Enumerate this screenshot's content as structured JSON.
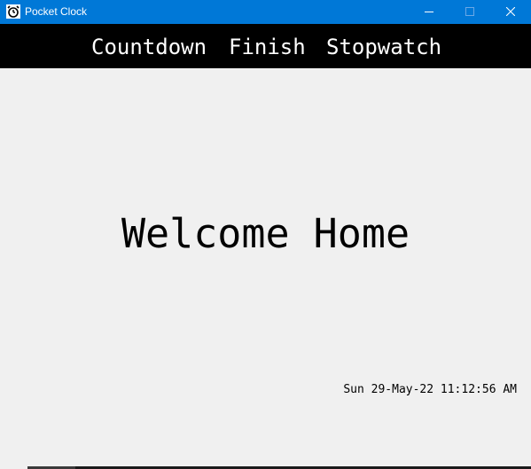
{
  "window": {
    "title": "Pocket Clock",
    "titlebar_color": "#0078d7",
    "icon": "alarm-clock-icon"
  },
  "controls": {
    "minimize_icon": "minimize-icon",
    "maximize_icon": "maximize-icon",
    "close_icon": "close-icon"
  },
  "menu": {
    "background": "#000000",
    "items": [
      {
        "label": "Countdown"
      },
      {
        "label": "Finish"
      },
      {
        "label": "Stopwatch"
      }
    ]
  },
  "main": {
    "heading": "Welcome Home",
    "datetime": "Sun 29-May-22 11:12:56 AM",
    "background": "#f0f0f0"
  }
}
